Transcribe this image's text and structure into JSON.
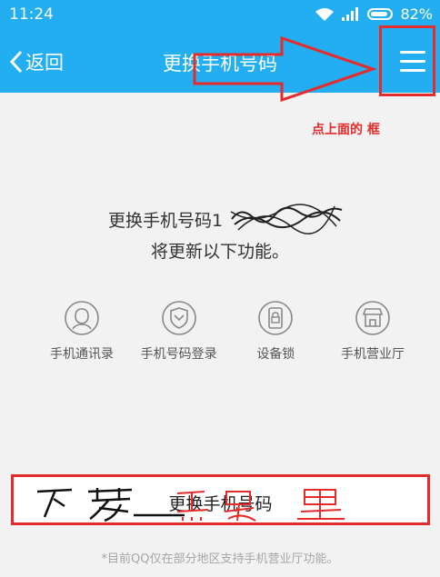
{
  "status_bar": {
    "time": "11:24",
    "battery": "82%"
  },
  "nav": {
    "back_label": "返回",
    "title": "更换手机号码"
  },
  "annotation": {
    "hint": "点上面的  框"
  },
  "description": {
    "line1": "更换手机号码1",
    "line2": "将更新以下功能。"
  },
  "features": [
    {
      "icon": "contact-user-icon",
      "label": "手机通讯录"
    },
    {
      "icon": "shield-check-icon",
      "label": "手机号码登录"
    },
    {
      "icon": "device-lock-icon",
      "label": "设备锁"
    },
    {
      "icon": "store-icon",
      "label": "手机营业厅"
    }
  ],
  "action": {
    "label": "更换手机号码"
  },
  "footnote": "*目前QQ仅在部分地区支持手机营业厅功能。",
  "colors": {
    "header": "#22aef0",
    "annotation": "#e52b2b"
  }
}
